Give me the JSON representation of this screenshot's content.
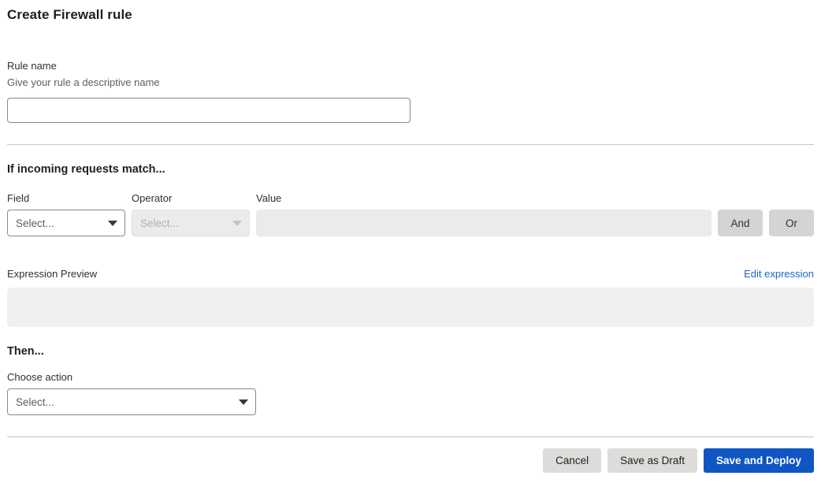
{
  "page": {
    "title": "Create Firewall rule"
  },
  "rule_name": {
    "label": "Rule name",
    "help": "Give your rule a descriptive name",
    "value": "",
    "placeholder": ""
  },
  "match_section": {
    "heading": "If incoming requests match...",
    "columns": {
      "field": "Field",
      "operator": "Operator",
      "value": "Value"
    },
    "condition": {
      "field_value": "Select...",
      "operator_value": "Select...",
      "value_value": "",
      "value_placeholder": "",
      "and_label": "And",
      "or_label": "Or"
    }
  },
  "expression": {
    "label": "Expression Preview",
    "edit_link": "Edit expression",
    "preview_text": ""
  },
  "then_section": {
    "heading": "Then...",
    "action_label": "Choose action",
    "action_value": "Select..."
  },
  "footer": {
    "cancel_label": "Cancel",
    "draft_label": "Save as Draft",
    "deploy_label": "Save and Deploy"
  },
  "colors": {
    "primary": "#0f56c3",
    "link": "#1966d2",
    "border": "#8a8886",
    "disabled_fill": "#ebebeb",
    "preview_fill": "#f0f0f0"
  }
}
